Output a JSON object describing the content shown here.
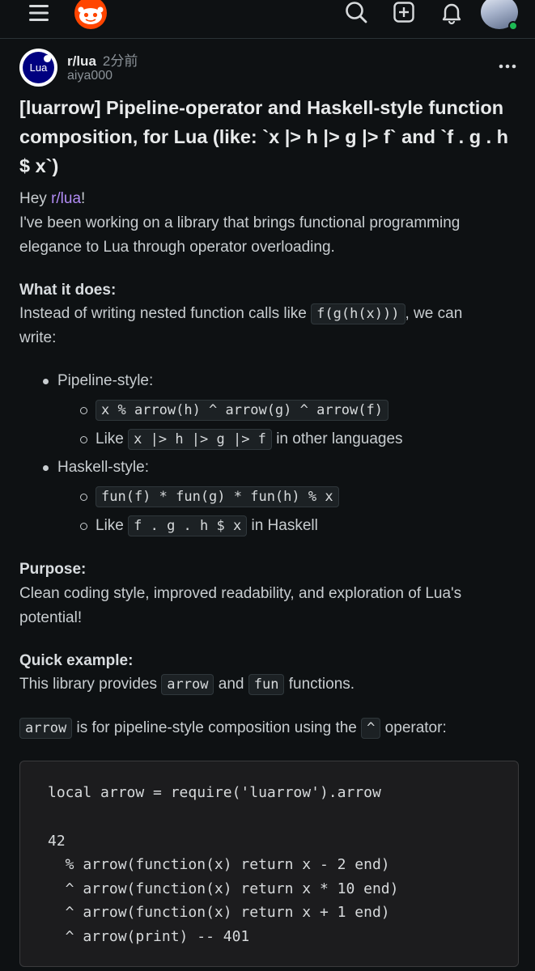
{
  "post": {
    "subreddit": "r/lua",
    "age": "2分前",
    "author": "aiya000",
    "subreddit_icon_text": "Lua",
    "title": "[luarrow] Pipeline-operator and Haskell-style function composition, for Lua (like: `x |> h |> g |> f` and `f . g . h $ x`)"
  },
  "body": {
    "greeting_prefix": "Hey ",
    "greeting_link": "r/lua",
    "greeting_suffix": "!",
    "intro": "I've been working on a library that brings functional programming elegance to Lua through operator overloading.",
    "what_heading": "What it does:",
    "what_text_before": "Instead of writing nested function calls like ",
    "what_code": "f(g(h(x)))",
    "what_text_after": ", we can",
    "what_text_line2": "write:",
    "list": {
      "pipeline_label": "Pipeline-style:",
      "pipeline_code": "x % arrow(h) ^ arrow(g) ^ arrow(f)",
      "pipeline_like": "Like",
      "pipeline_like_code": "x |> h |> g |> f",
      "pipeline_like_suffix": "in other languages",
      "haskell_label": "Haskell-style:",
      "haskell_code": "fun(f) * fun(g) * fun(h) % x",
      "haskell_like": "Like",
      "haskell_like_code": "f . g . h $ x",
      "haskell_like_suffix": "in Haskell"
    },
    "purpose_heading": "Purpose:",
    "purpose_text": "Clean coding style, improved readability, and exploration of Lua's potential!",
    "quick_heading": "Quick example:",
    "quick_before": "This library provides ",
    "quick_code1": "arrow",
    "quick_and": " and ",
    "quick_code2": "fun",
    "quick_after": " functions.",
    "arrow_code": "arrow",
    "arrow_text": " is for pipeline-style composition using the ",
    "arrow_op": "^",
    "arrow_after": " operator:"
  },
  "code_block": [
    "local arrow = require('luarrow').arrow",
    "",
    "42",
    "  % arrow(function(x) return x - 2 end)",
    "  ^ arrow(function(x) return x * 10 end)",
    "  ^ arrow(function(x) return x + 1 end)",
    "  ^ arrow(print) -- 401"
  ],
  "colors": {
    "background": "#0e1113",
    "link": "#b28cf5",
    "brand": "#ff4500",
    "online": "#1db954"
  }
}
